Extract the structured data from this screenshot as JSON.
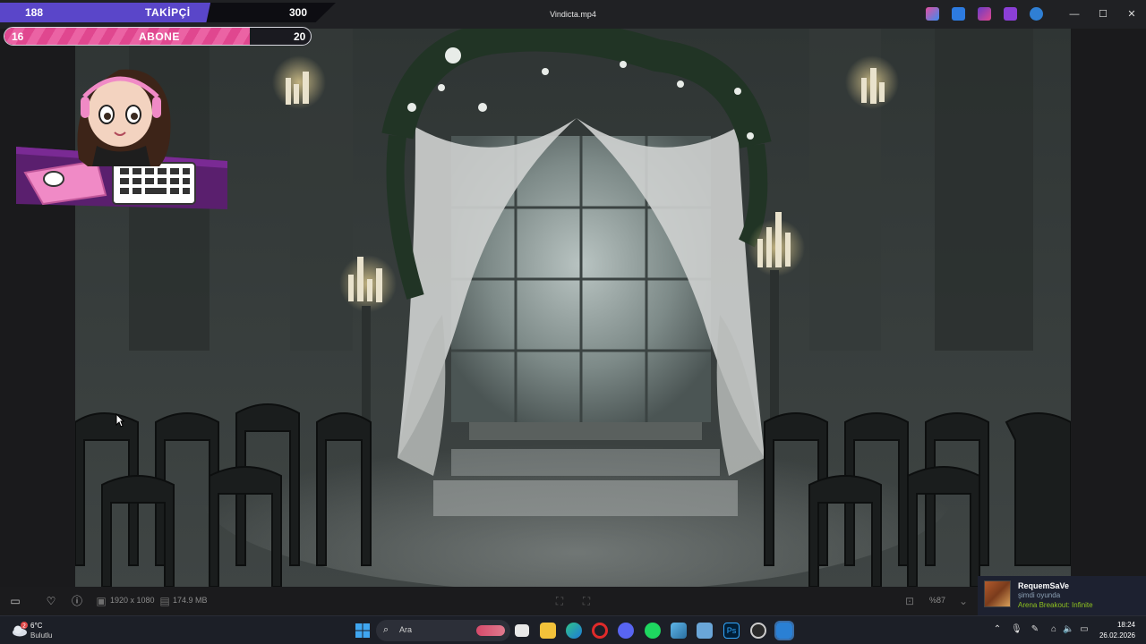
{
  "window": {
    "title": "Vindicta.mp4",
    "minimize": "—",
    "maximize": "☐",
    "close": "✕"
  },
  "overlay": {
    "follow_current": "188",
    "follow_label": "TAKİPÇİ",
    "follow_goal": "300",
    "follow_progress": 0.627,
    "sub_current": "16",
    "sub_label": "ABONE",
    "sub_goal": "20",
    "sub_progress": 0.8
  },
  "player": {
    "resolution": "1920 x 1080",
    "size": "174.9 MB",
    "zoom": "%87"
  },
  "notification": {
    "name": "RequemSaVe",
    "status": "şimdi oyunda",
    "game": "Arena Breakout: Infinite"
  },
  "taskbar": {
    "weather_temp": "6°C",
    "weather_desc": "Bulutlu",
    "weather_badge": "2",
    "search_placeholder": "Ara",
    "time": "18:24",
    "date": "26.02.2026"
  },
  "colors": {
    "follow_fill": "#5a46c9",
    "sub_fill": "#e0478f",
    "game_text": "#8fc31f"
  }
}
